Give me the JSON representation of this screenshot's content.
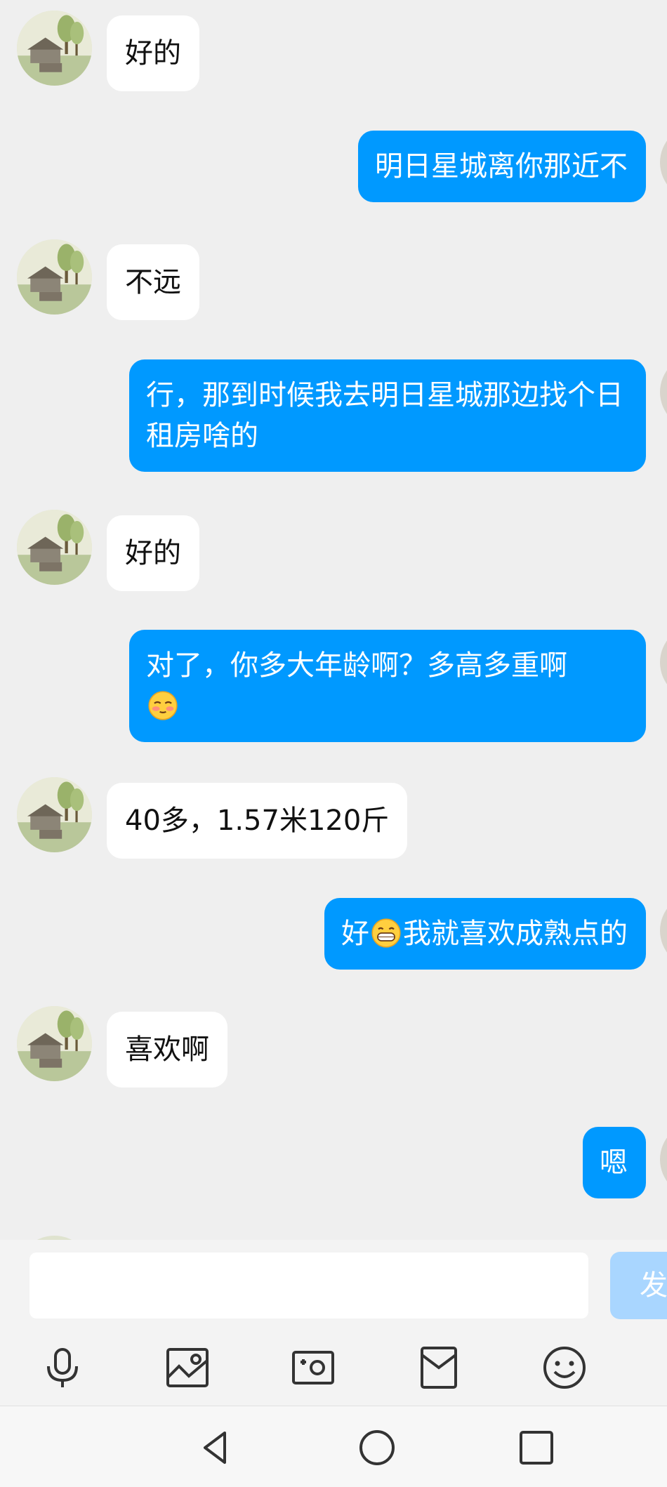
{
  "messages": [
    {
      "side": "in",
      "text": "好的"
    },
    {
      "side": "out",
      "text": "明日星城离你那近不"
    },
    {
      "side": "in",
      "text": "不远"
    },
    {
      "side": "out",
      "text": "行，那到时候我去明日星城那边找个日租房啥的"
    },
    {
      "side": "in",
      "text": "好的"
    },
    {
      "side": "out",
      "text": "对了，你多大年龄啊？多高多重啊",
      "emoji_after": "shy-face-emoji"
    },
    {
      "side": "in",
      "text": "40多，1.57米120斤"
    },
    {
      "side": "out",
      "text_before": "好",
      "emoji_mid": "grin-emoji",
      "text_after": "我就喜欢成熟点的"
    },
    {
      "side": "in",
      "text": "喜欢啊"
    },
    {
      "side": "out",
      "text": "嗯"
    }
  ],
  "input": {
    "value": "",
    "placeholder": ""
  },
  "send_button": {
    "label": "发"
  },
  "toolbar": {
    "icons": [
      "microphone-icon",
      "image-icon",
      "camera-icon",
      "red-packet-icon",
      "emoji-icon"
    ]
  },
  "navbar": {
    "icons": [
      "back-icon",
      "home-icon",
      "recents-icon"
    ]
  },
  "colors": {
    "outgoing_bubble": "#0099ff",
    "incoming_bubble": "#ffffff",
    "background": "#efefef",
    "send_button_disabled": "#a9d6ff"
  }
}
